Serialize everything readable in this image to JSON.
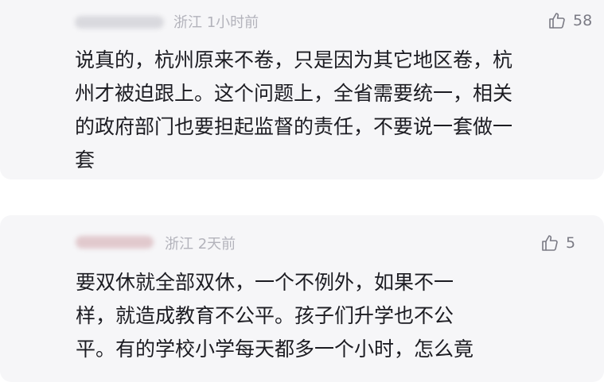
{
  "comments": [
    {
      "location": "浙江",
      "time": "1小时前",
      "likes": "58",
      "text": "说真的，杭州原来不卷，只是因为其它地区卷，杭\n州才被迫跟上。这个问题上，全省需要统一，相关\n的政府部门也要担起监督的责任，不要说一套做一\n套",
      "username": ""
    },
    {
      "location": "浙江",
      "time": "2天前",
      "likes": "5",
      "text": "要双休就全部双休，一个不例外，如果不一\n样，就造成教育不公平。孩子们升学也不公\n平。有的学校小学每天都多一个小时，怎么竟",
      "username": ""
    }
  ],
  "icons": {
    "like": "thumbs-up-icon"
  },
  "colors": {
    "card_bg": "#f6f6f8",
    "meta_text": "#b3b3bb",
    "body_text": "#1c1c22",
    "like_text": "#7a7a84"
  }
}
